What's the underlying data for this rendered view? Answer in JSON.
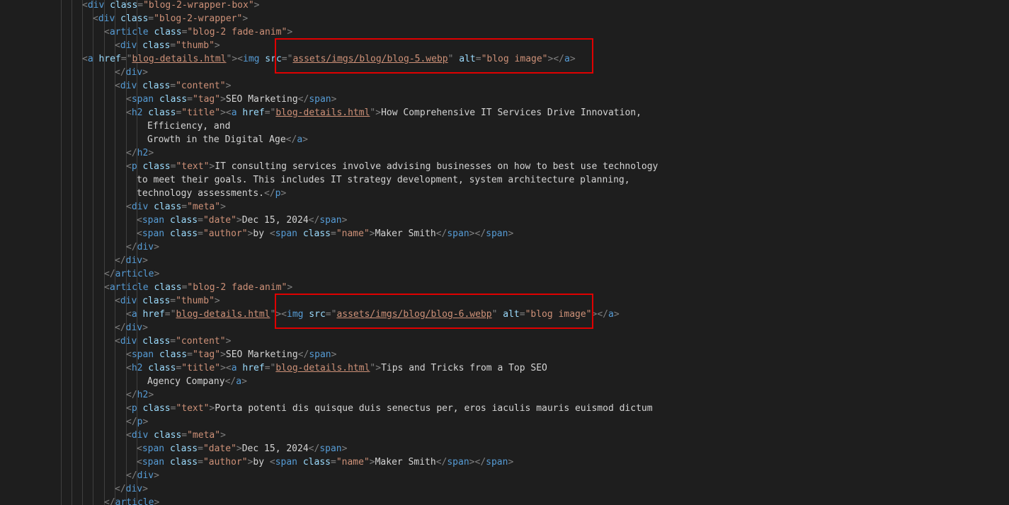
{
  "editor": {
    "colors": {
      "background": "#1e1e1e",
      "punctuation": "#808080",
      "tag": "#569cd6",
      "attribute": "#9cdcfe",
      "string": "#ce9178",
      "text": "#d4d4d4",
      "indent_guide": "#404040",
      "annotation": "#e00000"
    },
    "annotations": [
      {
        "label": "highlight-box",
        "line": 4
      },
      {
        "label": "highlight-box",
        "line": 23
      }
    ],
    "lines": [
      [
        [
          "p",
          "<"
        ],
        [
          "g",
          "div"
        ],
        [
          "a",
          " class"
        ],
        [
          "p",
          "="
        ],
        [
          "s",
          "\"blog-2-wrapper-box\""
        ],
        [
          "p",
          ">"
        ]
      ],
      [
        [
          "p",
          "<"
        ],
        [
          "g",
          "div"
        ],
        [
          "a",
          " class"
        ],
        [
          "p",
          "="
        ],
        [
          "s",
          "\"blog-2-wrapper\""
        ],
        [
          "p",
          ">"
        ]
      ],
      [
        [
          "p",
          "<"
        ],
        [
          "g",
          "article"
        ],
        [
          "a",
          " class"
        ],
        [
          "p",
          "="
        ],
        [
          "s",
          "\"blog-2 fade-anim\""
        ],
        [
          "p",
          ">"
        ]
      ],
      [
        [
          "p",
          "<"
        ],
        [
          "g",
          "div"
        ],
        [
          "a",
          " class"
        ],
        [
          "p",
          "="
        ],
        [
          "s",
          "\"thumb\""
        ],
        [
          "p",
          ">"
        ]
      ],
      [
        [
          "p",
          "<"
        ],
        [
          "g",
          "a"
        ],
        [
          "a",
          " href"
        ],
        [
          "p",
          "="
        ],
        [
          "p",
          "\""
        ],
        [
          "u",
          "blog-details.html"
        ],
        [
          "p",
          "\""
        ],
        [
          "p",
          ">"
        ],
        [
          "p",
          "<"
        ],
        [
          "g",
          "img"
        ],
        [
          "a",
          " src"
        ],
        [
          "p",
          "="
        ],
        [
          "p",
          "\""
        ],
        [
          "u",
          "assets/imgs/blog/blog-5.webp"
        ],
        [
          "p",
          "\""
        ],
        [
          "a",
          " alt"
        ],
        [
          "p",
          "="
        ],
        [
          "s",
          "\"blog image\""
        ],
        [
          "p",
          ">"
        ],
        [
          "p",
          "<"
        ],
        [
          "p",
          "/"
        ],
        [
          "g",
          "a"
        ],
        [
          "p",
          ">"
        ]
      ],
      [
        [
          "p",
          "</"
        ],
        [
          "g",
          "div"
        ],
        [
          "p",
          ">"
        ]
      ],
      [
        [
          "p",
          "<"
        ],
        [
          "g",
          "div"
        ],
        [
          "a",
          " class"
        ],
        [
          "p",
          "="
        ],
        [
          "s",
          "\"content\""
        ],
        [
          "p",
          ">"
        ]
      ],
      [
        [
          "p",
          "<"
        ],
        [
          "g",
          "span"
        ],
        [
          "a",
          " class"
        ],
        [
          "p",
          "="
        ],
        [
          "s",
          "\"tag\""
        ],
        [
          "p",
          ">"
        ],
        [
          "t",
          "SEO Marketing"
        ],
        [
          "p",
          "</"
        ],
        [
          "g",
          "span"
        ],
        [
          "p",
          ">"
        ]
      ],
      [
        [
          "p",
          "<"
        ],
        [
          "g",
          "h2"
        ],
        [
          "a",
          " class"
        ],
        [
          "p",
          "="
        ],
        [
          "s",
          "\"title\""
        ],
        [
          "p",
          ">"
        ],
        [
          "p",
          "<"
        ],
        [
          "g",
          "a"
        ],
        [
          "a",
          " href"
        ],
        [
          "p",
          "="
        ],
        [
          "p",
          "\""
        ],
        [
          "u",
          "blog-details.html"
        ],
        [
          "p",
          "\""
        ],
        [
          "p",
          ">"
        ],
        [
          "t",
          "How Comprehensive IT Services Drive Innovation,"
        ]
      ],
      [
        [
          "t",
          "Efficiency, and"
        ]
      ],
      [
        [
          "t",
          "Growth in the Digital Age"
        ],
        [
          "p",
          "</"
        ],
        [
          "g",
          "a"
        ],
        [
          "p",
          ">"
        ]
      ],
      [
        [
          "p",
          "</"
        ],
        [
          "g",
          "h2"
        ],
        [
          "p",
          ">"
        ]
      ],
      [
        [
          "p",
          "<"
        ],
        [
          "g",
          "p"
        ],
        [
          "a",
          " class"
        ],
        [
          "p",
          "="
        ],
        [
          "s",
          "\"text\""
        ],
        [
          "p",
          ">"
        ],
        [
          "t",
          "IT consulting services involve advising businesses on how to best use technology"
        ]
      ],
      [
        [
          "t",
          "to meet their goals. This includes IT strategy development, system architecture planning,"
        ]
      ],
      [
        [
          "t",
          "technology assessments."
        ],
        [
          "p",
          "</"
        ],
        [
          "g",
          "p"
        ],
        [
          "p",
          ">"
        ]
      ],
      [
        [
          "p",
          "<"
        ],
        [
          "g",
          "div"
        ],
        [
          "a",
          " class"
        ],
        [
          "p",
          "="
        ],
        [
          "s",
          "\"meta\""
        ],
        [
          "p",
          ">"
        ]
      ],
      [
        [
          "p",
          "<"
        ],
        [
          "g",
          "span"
        ],
        [
          "a",
          " class"
        ],
        [
          "p",
          "="
        ],
        [
          "s",
          "\"date\""
        ],
        [
          "p",
          ">"
        ],
        [
          "t",
          "Dec 15, 2024"
        ],
        [
          "p",
          "</"
        ],
        [
          "g",
          "span"
        ],
        [
          "p",
          ">"
        ]
      ],
      [
        [
          "p",
          "<"
        ],
        [
          "g",
          "span"
        ],
        [
          "a",
          " class"
        ],
        [
          "p",
          "="
        ],
        [
          "s",
          "\"author\""
        ],
        [
          "p",
          ">"
        ],
        [
          "t",
          "by "
        ],
        [
          "p",
          "<"
        ],
        [
          "g",
          "span"
        ],
        [
          "a",
          " class"
        ],
        [
          "p",
          "="
        ],
        [
          "s",
          "\"name\""
        ],
        [
          "p",
          ">"
        ],
        [
          "t",
          "Maker Smith"
        ],
        [
          "p",
          "</"
        ],
        [
          "g",
          "span"
        ],
        [
          "p",
          ">"
        ],
        [
          "p",
          "</"
        ],
        [
          "g",
          "span"
        ],
        [
          "p",
          ">"
        ]
      ],
      [
        [
          "p",
          "</"
        ],
        [
          "g",
          "div"
        ],
        [
          "p",
          ">"
        ]
      ],
      [
        [
          "p",
          "</"
        ],
        [
          "g",
          "div"
        ],
        [
          "p",
          ">"
        ]
      ],
      [
        [
          "p",
          "</"
        ],
        [
          "g",
          "article"
        ],
        [
          "p",
          ">"
        ]
      ],
      [
        [
          "p",
          "<"
        ],
        [
          "g",
          "article"
        ],
        [
          "a",
          " class"
        ],
        [
          "p",
          "="
        ],
        [
          "s",
          "\"blog-2 fade-anim\""
        ],
        [
          "p",
          ">"
        ]
      ],
      [
        [
          "p",
          "<"
        ],
        [
          "g",
          "div"
        ],
        [
          "a",
          " class"
        ],
        [
          "p",
          "="
        ],
        [
          "s",
          "\"thumb\""
        ],
        [
          "p",
          ">"
        ]
      ],
      [
        [
          "p",
          "<"
        ],
        [
          "g",
          "a"
        ],
        [
          "a",
          " href"
        ],
        [
          "p",
          "="
        ],
        [
          "p",
          "\""
        ],
        [
          "u",
          "blog-details.html"
        ],
        [
          "p",
          "\""
        ],
        [
          "p",
          ">"
        ],
        [
          "p",
          "<"
        ],
        [
          "g",
          "img"
        ],
        [
          "a",
          " src"
        ],
        [
          "p",
          "="
        ],
        [
          "p",
          "\""
        ],
        [
          "u",
          "assets/imgs/blog/blog-6.webp"
        ],
        [
          "p",
          "\""
        ],
        [
          "a",
          " alt"
        ],
        [
          "p",
          "="
        ],
        [
          "s",
          "\"blog image\""
        ],
        [
          "p",
          ">"
        ],
        [
          "p",
          "<"
        ],
        [
          "p",
          "/"
        ],
        [
          "g",
          "a"
        ],
        [
          "p",
          ">"
        ]
      ],
      [
        [
          "p",
          "</"
        ],
        [
          "g",
          "div"
        ],
        [
          "p",
          ">"
        ]
      ],
      [
        [
          "p",
          "<"
        ],
        [
          "g",
          "div"
        ],
        [
          "a",
          " class"
        ],
        [
          "p",
          "="
        ],
        [
          "s",
          "\"content\""
        ],
        [
          "p",
          ">"
        ]
      ],
      [
        [
          "p",
          "<"
        ],
        [
          "g",
          "span"
        ],
        [
          "a",
          " class"
        ],
        [
          "p",
          "="
        ],
        [
          "s",
          "\"tag\""
        ],
        [
          "p",
          ">"
        ],
        [
          "t",
          "SEO Marketing"
        ],
        [
          "p",
          "</"
        ],
        [
          "g",
          "span"
        ],
        [
          "p",
          ">"
        ]
      ],
      [
        [
          "p",
          "<"
        ],
        [
          "g",
          "h2"
        ],
        [
          "a",
          " class"
        ],
        [
          "p",
          "="
        ],
        [
          "s",
          "\"title\""
        ],
        [
          "p",
          ">"
        ],
        [
          "p",
          "<"
        ],
        [
          "g",
          "a"
        ],
        [
          "a",
          " href"
        ],
        [
          "p",
          "="
        ],
        [
          "p",
          "\""
        ],
        [
          "u",
          "blog-details.html"
        ],
        [
          "p",
          "\""
        ],
        [
          "p",
          ">"
        ],
        [
          "t",
          "Tips and Tricks from a Top SEO"
        ]
      ],
      [
        [
          "t",
          "Agency Company"
        ],
        [
          "p",
          "</"
        ],
        [
          "g",
          "a"
        ],
        [
          "p",
          ">"
        ]
      ],
      [
        [
          "p",
          "</"
        ],
        [
          "g",
          "h2"
        ],
        [
          "p",
          ">"
        ]
      ],
      [
        [
          "p",
          "<"
        ],
        [
          "g",
          "p"
        ],
        [
          "a",
          " class"
        ],
        [
          "p",
          "="
        ],
        [
          "s",
          "\"text\""
        ],
        [
          "p",
          ">"
        ],
        [
          "t",
          "Porta potenti dis quisque duis senectus per, eros iaculis mauris euismod dictum"
        ]
      ],
      [
        [
          "p",
          "</"
        ],
        [
          "g",
          "p"
        ],
        [
          "p",
          ">"
        ]
      ],
      [
        [
          "p",
          "<"
        ],
        [
          "g",
          "div"
        ],
        [
          "a",
          " class"
        ],
        [
          "p",
          "="
        ],
        [
          "s",
          "\"meta\""
        ],
        [
          "p",
          ">"
        ]
      ],
      [
        [
          "p",
          "<"
        ],
        [
          "g",
          "span"
        ],
        [
          "a",
          " class"
        ],
        [
          "p",
          "="
        ],
        [
          "s",
          "\"date\""
        ],
        [
          "p",
          ">"
        ],
        [
          "t",
          "Dec 15, 2024"
        ],
        [
          "p",
          "</"
        ],
        [
          "g",
          "span"
        ],
        [
          "p",
          ">"
        ]
      ],
      [
        [
          "p",
          "<"
        ],
        [
          "g",
          "span"
        ],
        [
          "a",
          " class"
        ],
        [
          "p",
          "="
        ],
        [
          "s",
          "\"author\""
        ],
        [
          "p",
          ">"
        ],
        [
          "t",
          "by "
        ],
        [
          "p",
          "<"
        ],
        [
          "g",
          "span"
        ],
        [
          "a",
          " class"
        ],
        [
          "p",
          "="
        ],
        [
          "s",
          "\"name\""
        ],
        [
          "p",
          ">"
        ],
        [
          "t",
          "Maker Smith"
        ],
        [
          "p",
          "</"
        ],
        [
          "g",
          "span"
        ],
        [
          "p",
          ">"
        ],
        [
          "p",
          "</"
        ],
        [
          "g",
          "span"
        ],
        [
          "p",
          ">"
        ]
      ],
      [
        [
          "p",
          "</"
        ],
        [
          "g",
          "div"
        ],
        [
          "p",
          ">"
        ]
      ],
      [
        [
          "p",
          "</"
        ],
        [
          "g",
          "div"
        ],
        [
          "p",
          ">"
        ]
      ],
      [
        [
          "p",
          "</"
        ],
        [
          "g",
          "article"
        ],
        [
          "p",
          ">"
        ]
      ]
    ]
  }
}
